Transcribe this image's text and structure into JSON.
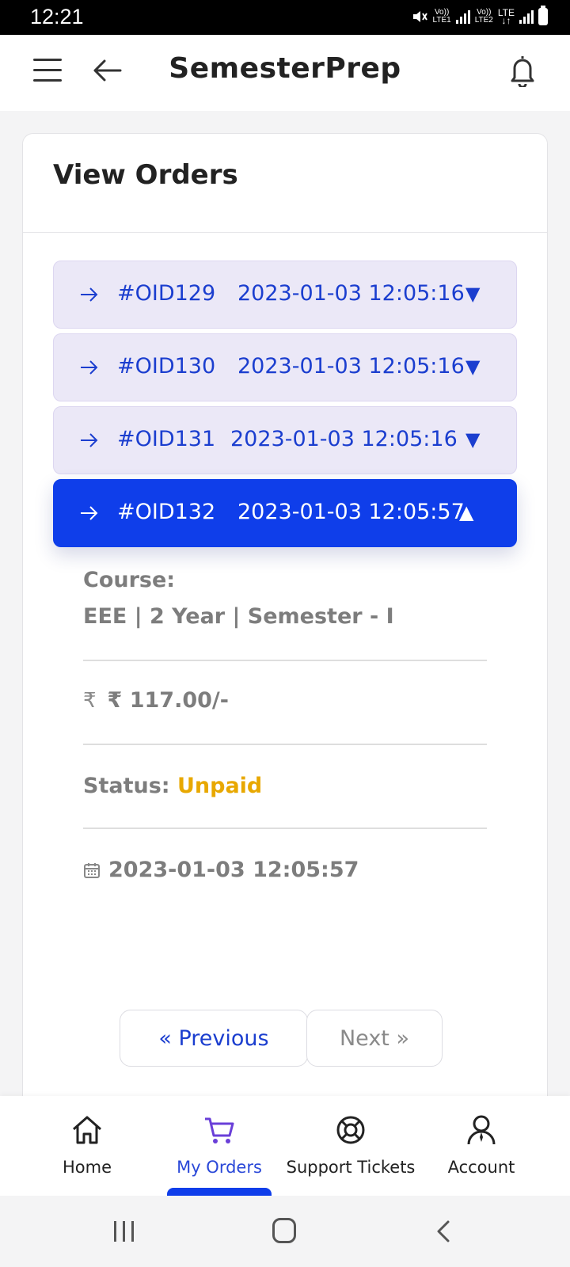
{
  "status_bar": {
    "time": "12:21",
    "sim1": {
      "top": "Vo))",
      "bottom": "LTE1"
    },
    "sim2": {
      "top": "Vo))",
      "bottom": "LTE2"
    },
    "net_type": "LTE"
  },
  "header": {
    "title": "SemesterPrep",
    "icons": [
      "menu-icon",
      "back-arrow-icon",
      "bell-icon"
    ]
  },
  "page": {
    "title": "View Orders"
  },
  "orders": [
    {
      "id": "#OID129",
      "datetime": "2023-01-03 12:05:16",
      "caret": "▼",
      "expanded": false
    },
    {
      "id": "#OID130",
      "datetime": "2023-01-03 12:05:16",
      "caret": "▼",
      "expanded": false
    },
    {
      "id": "#OID131",
      "datetime": "2023-01-03 12:05:16",
      "caret": "▼",
      "expanded": false
    },
    {
      "id": "#OID132",
      "datetime": "2023-01-03 12:05:57",
      "caret": "▲",
      "expanded": true
    }
  ],
  "order_details": {
    "course_label": "Course:",
    "course_value": "EEE | 2 Year | Semester - I",
    "rupee_symbol": "₹",
    "price": "₹ 117.00/-",
    "status_label": "Status:",
    "status_value": "Unpaid",
    "status_color": "#e8a800",
    "date": "2023-01-03 12:05:57"
  },
  "pagination": {
    "previous": "« Previous",
    "next": "Next »"
  },
  "bottom_nav": [
    {
      "label": "Home",
      "icon": "home-icon",
      "active": false
    },
    {
      "label": "My Orders",
      "icon": "cart-icon",
      "active": true
    },
    {
      "label": "Support Tickets",
      "icon": "lifebuoy-icon",
      "active": false
    },
    {
      "label": "Account",
      "icon": "account-icon",
      "active": false
    }
  ],
  "colors": {
    "accent": "#0f3eea",
    "order_bg": "#ebe8f7",
    "order_text": "#1b3ecf",
    "muted_text": "#7d7d7d"
  }
}
